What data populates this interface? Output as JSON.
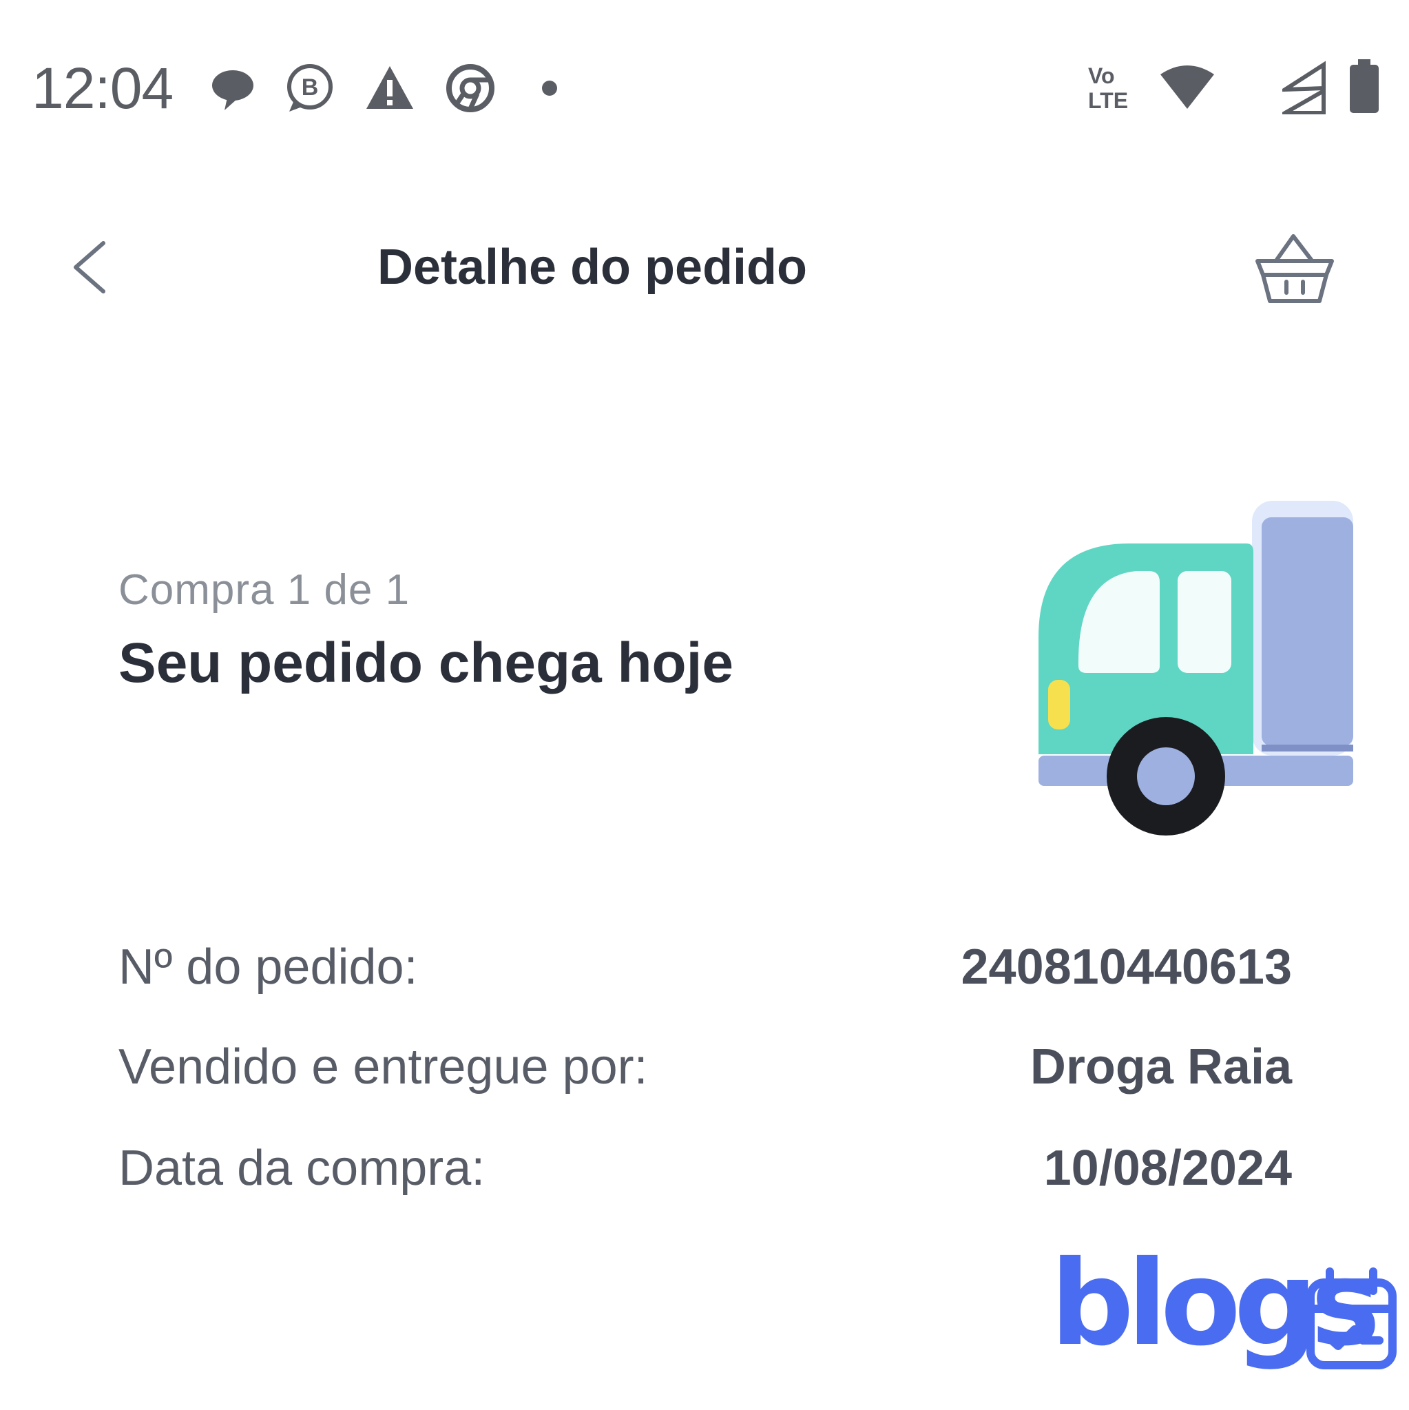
{
  "status_bar": {
    "time": "12:04",
    "left_icons": [
      "chat-bubble-icon",
      "whatsapp-business-icon",
      "warning-icon",
      "chrome-icon",
      "notification-dot-icon"
    ],
    "right_icons": [
      "volte-icon",
      "wifi-icon",
      "signal-icon",
      "battery-icon"
    ],
    "volte_top": "Vo",
    "volte_bottom": "LTE"
  },
  "header": {
    "title": "Detalhe do pedido",
    "back_icon": "chevron-left-icon",
    "basket_icon": "basket-icon"
  },
  "order_status": {
    "purchase_count": "Compra 1 de 1",
    "heading": "Seu pedido chega hoje",
    "illustration": "delivery-truck-icon"
  },
  "details": [
    {
      "label": "Nº do pedido:",
      "value": "240810440613"
    },
    {
      "label": "Vendido e entregue por:",
      "value": "Droga Raia"
    },
    {
      "label": "Data da compra:",
      "value": "10/08/2024"
    }
  ],
  "watermark": {
    "text": "blogs",
    "icon": "calendar-check-icon"
  },
  "colors": {
    "accent": "#4a6cf0",
    "truck_cab": "#5fd6c3",
    "truck_body": "#9eb0e0",
    "text_dark": "#2b2f3a",
    "text_muted": "#8a8f98"
  }
}
